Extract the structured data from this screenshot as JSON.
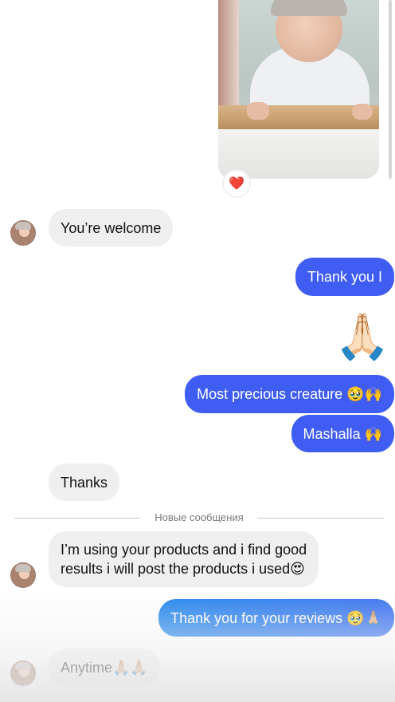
{
  "conversation": {
    "shared_photo": {
      "reaction": "❤️"
    },
    "messages": [
      {
        "id": "m1",
        "direction": "incoming",
        "text": "You’re welcome"
      },
      {
        "id": "m2",
        "direction": "outgoing",
        "text": "Thank you I"
      },
      {
        "id": "m3",
        "direction": "outgoing",
        "emoji": "🙏🏻"
      },
      {
        "id": "m4",
        "direction": "outgoing",
        "text": "Most precious creature 🥹🙌"
      },
      {
        "id": "m5",
        "direction": "outgoing",
        "text": "Mashalla 🙌"
      },
      {
        "id": "m6",
        "direction": "incoming",
        "text": "Thanks"
      },
      {
        "id": "m7",
        "direction": "incoming",
        "line1": "I’m using your products and i find good",
        "line2": "results i will post the products i used😍"
      },
      {
        "id": "m8",
        "direction": "outgoing",
        "text": "Thank you for your reviews 🥹🙏🏼"
      },
      {
        "id": "m9",
        "direction": "incoming",
        "text": "Anytime🙏🏼🙏🏼"
      }
    ],
    "new_messages_divider": "Новые сообщения"
  },
  "colors": {
    "outgoing_bubble": "#3f5cf3",
    "incoming_bubble": "#efefef",
    "outgoing_gradient_start": "#1f85ec"
  }
}
